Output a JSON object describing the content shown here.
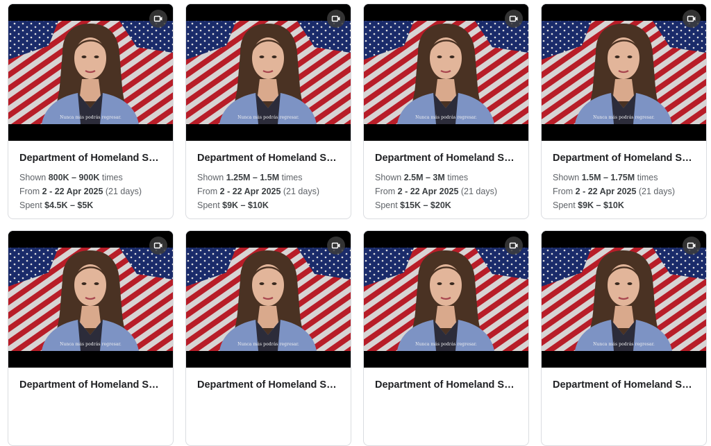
{
  "cards": [
    {
      "title": "Department of Homeland Se...",
      "subtitle": "Nunca más podrás regresar.",
      "shown_prefix": "Shown ",
      "shown": "800K – 900K",
      "shown_suffix": " times",
      "from_prefix": "From ",
      "dates": "2 - 22 Apr 2025",
      "days": " (21 days)",
      "spent_prefix": "Spent ",
      "spent": "$4.5K – $5K",
      "icon": "video-icon"
    },
    {
      "title": "Department of Homeland Se...",
      "subtitle": "Nunca más podrás regresar.",
      "shown_prefix": "Shown ",
      "shown": "1.25M – 1.5M",
      "shown_suffix": " times",
      "from_prefix": "From ",
      "dates": "2 - 22 Apr 2025",
      "days": " (21 days)",
      "spent_prefix": "Spent ",
      "spent": "$9K – $10K",
      "icon": "video-icon"
    },
    {
      "title": "Department of Homeland Se...",
      "subtitle": "Nunca más podrás regresar.",
      "shown_prefix": "Shown ",
      "shown": "2.5M – 3M",
      "shown_suffix": " times",
      "from_prefix": "From ",
      "dates": "2 - 22 Apr 2025",
      "days": " (21 days)",
      "spent_prefix": "Spent ",
      "spent": "$15K – $20K",
      "icon": "video-icon"
    },
    {
      "title": "Department of Homeland Se...",
      "subtitle": "Nunca más podrás regresar.",
      "shown_prefix": "Shown ",
      "shown": "1.5M – 1.75M",
      "shown_suffix": " times",
      "from_prefix": "From ",
      "dates": "2 - 22 Apr 2025",
      "days": " (21 days)",
      "spent_prefix": "Spent ",
      "spent": "$9K – $10K",
      "icon": "video-icon"
    },
    {
      "title": "Department of Homeland Se...",
      "subtitle": "Nunca más podrás regresar.",
      "icon": "video-icon"
    },
    {
      "title": "Department of Homeland Se...",
      "subtitle": "Nunca más podrás regresar.",
      "icon": "video-icon"
    },
    {
      "title": "Department of Homeland Se...",
      "subtitle": "Nunca más podrás regresar.",
      "icon": "video-icon"
    },
    {
      "title": "Department of Homeland Se...",
      "subtitle": "Nunca más podrás regresar.",
      "icon": "video-icon"
    }
  ]
}
